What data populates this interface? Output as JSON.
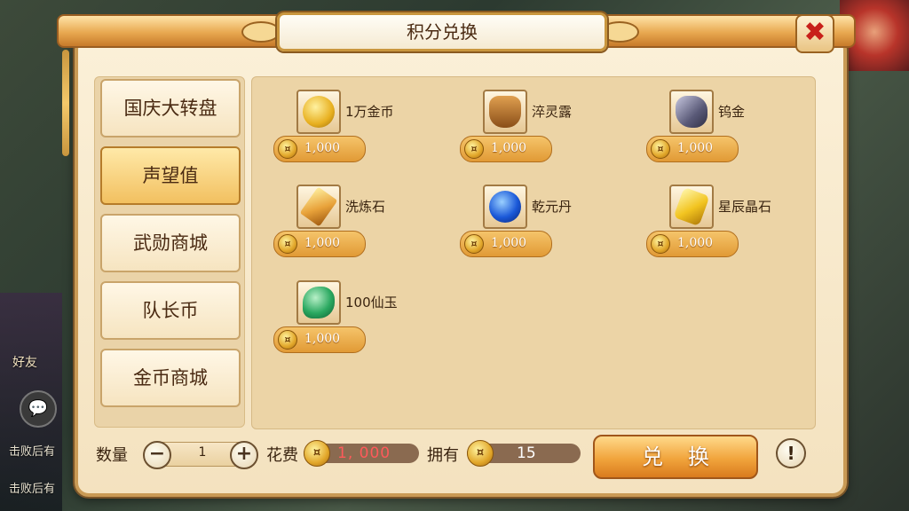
{
  "window": {
    "title": "积分兑换"
  },
  "background": {
    "friend_label": "好友",
    "chat_icon": "speech-bubble-icon",
    "messages": [
      "击败后有",
      "击败后有"
    ]
  },
  "sidebar": {
    "items": [
      {
        "label": "国庆大转盘",
        "active": false
      },
      {
        "label": "声望值",
        "active": true
      },
      {
        "label": "武勋商城",
        "active": false
      },
      {
        "label": "队长币",
        "active": false
      },
      {
        "label": "金币商城",
        "active": false
      }
    ]
  },
  "items": [
    {
      "name": "1万金币",
      "price": "1,000",
      "icon": "gold-coin-icon",
      "color": "#e8b020"
    },
    {
      "name": "淬灵露",
      "price": "1,000",
      "icon": "potion-jar-icon",
      "color": "#b8762a"
    },
    {
      "name": "钨金",
      "price": "1,000",
      "icon": "ore-stone-icon",
      "color": "#6a6a88"
    },
    {
      "name": "洗炼石",
      "price": "1,000",
      "icon": "crystal-icon",
      "color": "#e8a23a"
    },
    {
      "name": "乾元丹",
      "price": "1,000",
      "icon": "blue-orb-icon",
      "color": "#1a58d8"
    },
    {
      "name": "星辰晶石",
      "price": "1,000",
      "icon": "star-crystal-icon",
      "color": "#f2c420"
    },
    {
      "name": "100仙玉",
      "price": "1,000",
      "icon": "jade-icon",
      "color": "#2aa860"
    }
  ],
  "bottom": {
    "quantity_label": "数量",
    "quantity_value": "1",
    "minus": "−",
    "plus": "+",
    "cost_label": "花费",
    "cost_value": "1, 000",
    "own_label": "拥有",
    "own_value": "15",
    "exchange_label": "兑换",
    "info": "!"
  },
  "close": "✖"
}
